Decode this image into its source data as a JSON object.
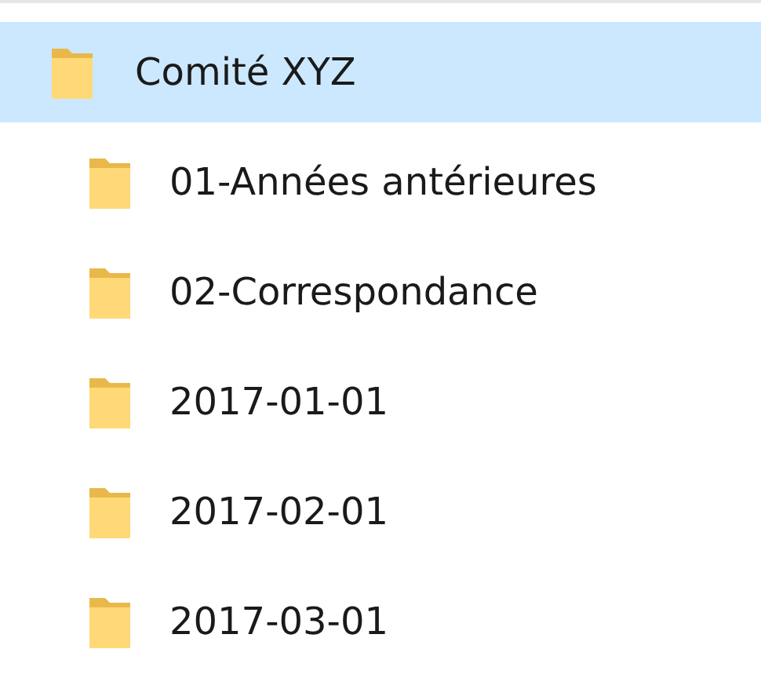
{
  "tree": [
    {
      "label": "Comité XYZ",
      "selected": true,
      "children": [
        {
          "label": "01-Années antérieures",
          "selected": false
        },
        {
          "label": "02-Correspondance",
          "selected": false
        },
        {
          "label": "2017-01-01",
          "selected": false
        },
        {
          "label": "2017-02-01",
          "selected": false
        },
        {
          "label": "2017-03-01",
          "selected": false
        }
      ]
    }
  ]
}
